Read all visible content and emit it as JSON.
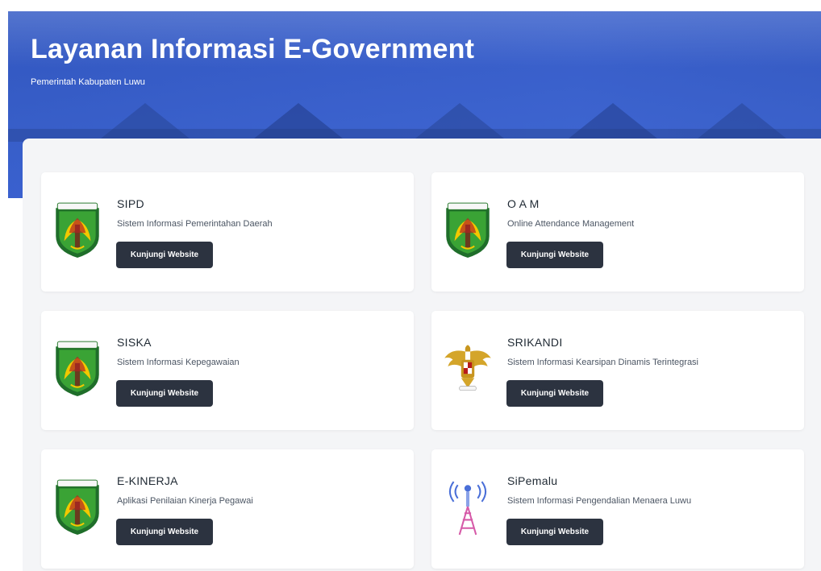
{
  "hero": {
    "title": "Layanan Informasi E-Government",
    "subtitle": "Pemerintah Kabupaten Luwu"
  },
  "colors": {
    "hero_blue": "#3a5fc0",
    "button_dark": "#2c3340",
    "panel_bg": "#f4f5f7",
    "emblem_green": "#2e8b2e",
    "emblem_yellow": "#f2c800"
  },
  "services": [
    {
      "title": "SIPD",
      "description": "Sistem Informasi Pemerintahan Daerah",
      "button": "Kunjungi Website",
      "icon": "luwu-emblem-icon"
    },
    {
      "title": "O A M",
      "description": "Online Attendance Management",
      "button": "Kunjungi Website",
      "icon": "luwu-emblem-icon"
    },
    {
      "title": "SISKA",
      "description": "Sistem Informasi Kepegawaian",
      "button": "Kunjungi Website",
      "icon": "luwu-emblem-icon"
    },
    {
      "title": "SRIKANDI",
      "description": "Sistem Informasi Kearsipan Dinamis Terintegrasi",
      "button": "Kunjungi Website",
      "icon": "garuda-icon"
    },
    {
      "title": "E-KINERJA",
      "description": "Aplikasi Penilaian Kinerja Pegawai",
      "button": "Kunjungi Website",
      "icon": "luwu-emblem-icon"
    },
    {
      "title": "SiPemalu",
      "description": "Sistem Informasi Pengendalian Menaera Luwu",
      "button": "Kunjungi Website",
      "icon": "radio-tower-icon"
    }
  ]
}
